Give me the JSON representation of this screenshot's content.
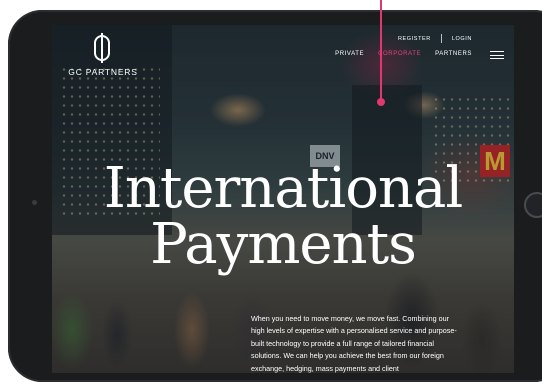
{
  "brand": {
    "name": "GC PARTNERS"
  },
  "top_nav": {
    "register": "REGISTER",
    "login": "LOGIN"
  },
  "main_nav": [
    {
      "label": "PRIVATE",
      "active": false
    },
    {
      "label": "CORPORATE",
      "active": true
    },
    {
      "label": "PARTNERS",
      "active": false
    }
  ],
  "hero": {
    "title_line1": "International",
    "title_line2": "Payments",
    "intro": "When you need to move money, we move fast. Combining our high levels of expertise with a personalised service and purpose-built technology to provide a full range of tailored financial solutions. We can help you achieve the best from our foreign exchange, hedging, mass payments and client"
  },
  "background_signs": {
    "dnv": "DNV",
    "m": "M"
  },
  "colors": {
    "accent": "#e2366f",
    "bezel": "#1b1c1e",
    "text": "#ffffff"
  },
  "icons": {
    "menu": "hamburger-menu-icon",
    "logo": "gc-logo-icon"
  }
}
